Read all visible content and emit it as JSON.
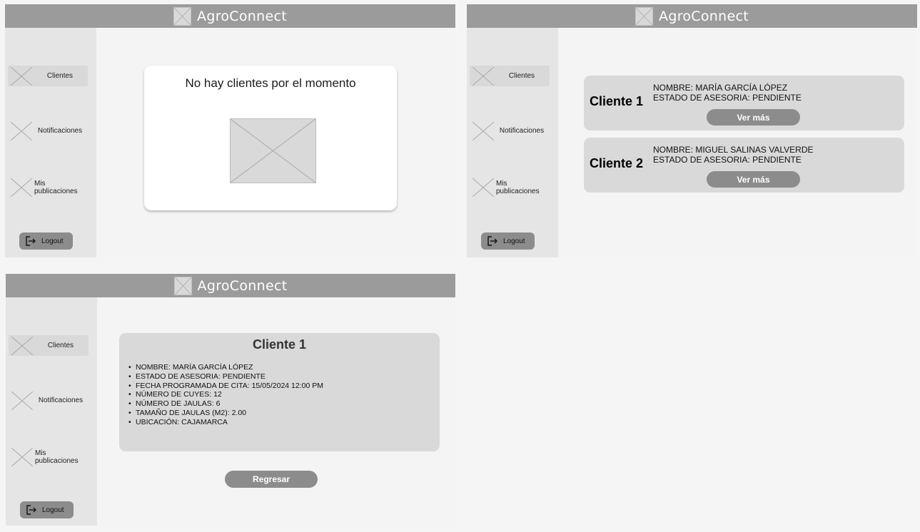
{
  "app": {
    "title": "AgroConnect"
  },
  "sidebar": {
    "items": [
      {
        "label": "Clientes"
      },
      {
        "label": "Notificaciones"
      },
      {
        "label": "Mis publicaciones"
      }
    ],
    "logout_label": "Logout"
  },
  "screen1": {
    "empty_message": "No hay clientes por el momento"
  },
  "screen2": {
    "clients": [
      {
        "title": "Cliente 1",
        "nombre": "NOMBRE: MARÍA GARCÍA LÓPEZ",
        "estado": "ESTADO DE ASESORIA: PENDIENTE",
        "button": "Ver más"
      },
      {
        "title": "Cliente 2",
        "nombre": "NOMBRE: MIGUEL SALINAS VALVERDE",
        "estado": "ESTADO DE ASESORIA: PENDIENTE",
        "button": "Ver más"
      }
    ]
  },
  "screen3": {
    "title": "Cliente 1",
    "details": [
      "NOMBRE: MARÍA GARCÍA LÓPEZ",
      "ESTADO DE ASESORIA: PENDIENTE",
      "FECHA PROGRAMADA DE CITA: 15/05/2024 12:00 PM",
      "NÚMERO DE CUYES: 12",
      "NÚMERO DE JAULAS: 6",
      "TAMAÑO DE JAULAS (M2): 2.00",
      "UBICACIÓN: CAJAMARCA"
    ],
    "back_button": "Regresar"
  },
  "icons": {
    "logo": "image-placeholder-icon",
    "nav": "image-placeholder-icon",
    "logout": "logout-icon"
  },
  "colors": {
    "topbar": "#9b9b9b",
    "sidebar": "#e5e5e5",
    "card": "#d9d9d9",
    "button": "#8c8c8c"
  }
}
